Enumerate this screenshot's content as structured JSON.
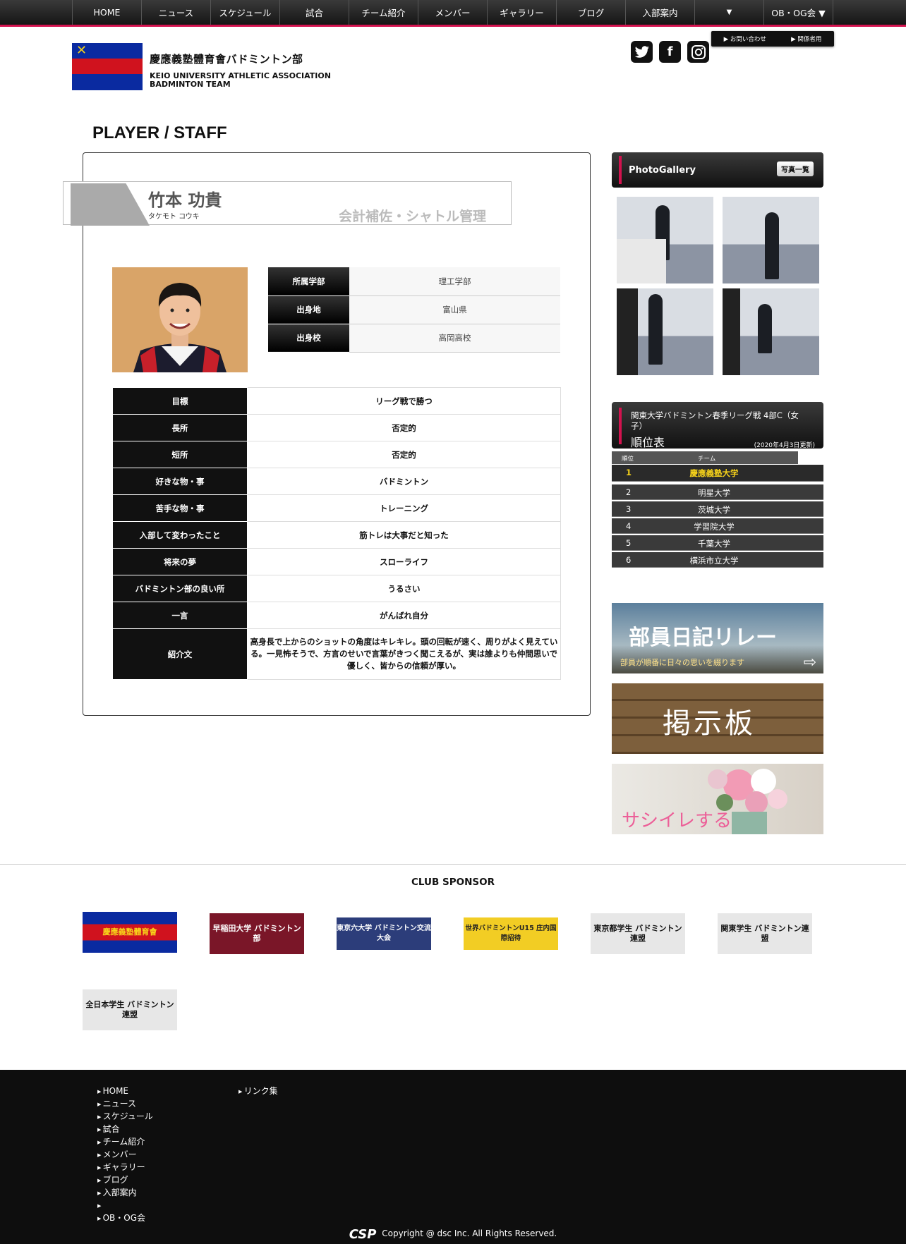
{
  "nav": {
    "items": [
      "HOME",
      "ニュース",
      "スケジュール",
      "試合",
      "チーム紹介",
      "メンバー",
      "ギャラリー",
      "ブログ",
      "入部案内",
      "▼",
      "OB・OG会 ▼"
    ],
    "sub": [
      "▶ お問い合わせ",
      "▶ 関係者用"
    ]
  },
  "site": {
    "title": "慶應義塾體育會バドミントン部",
    "subtitle": "KEIO UNIVERSITY ATHLETIC ASSOCIATION BADMINTON TEAM",
    "social": [
      "twitter-icon",
      "facebook-icon",
      "instagram-icon"
    ]
  },
  "page_title": "PLAYER / STAFF",
  "player": {
    "name": "竹本 功貴",
    "kana": "タケモト コウキ",
    "role": "会計補佐・シャトル管理",
    "info": [
      {
        "k": "所属学部",
        "v": "理工学部"
      },
      {
        "k": "出身地",
        "v": "富山県"
      },
      {
        "k": "出身校",
        "v": "高岡高校"
      }
    ],
    "profile": [
      {
        "k": "目標",
        "v": "リーグ戦で勝つ"
      },
      {
        "k": "長所",
        "v": "否定的"
      },
      {
        "k": "短所",
        "v": "否定的"
      },
      {
        "k": "好きな物・事",
        "v": "バドミントン"
      },
      {
        "k": "苦手な物・事",
        "v": "トレーニング"
      },
      {
        "k": "入部して変わったこと",
        "v": "筋トレは大事だと知った"
      },
      {
        "k": "将来の夢",
        "v": "スローライフ"
      },
      {
        "k": "バドミントン部の良い所",
        "v": "うるさい"
      },
      {
        "k": "一言",
        "v": "がんばれ自分"
      },
      {
        "k": "紹介文",
        "v": "高身長で上からのショットの角度はキレキレ。頭の回転が速く、周りがよく見えている。一見怖そうで、方言のせいで言葉がきつく聞こえるが、実は誰よりも仲間思いで優しく、皆からの信頼が厚い。"
      }
    ]
  },
  "gallery": {
    "title": "PhotoGallery",
    "button": "写真一覧"
  },
  "ranking": {
    "title": "関東大学バドミントン春季リーグ戦 4部C（女子）",
    "big": "順位表",
    "date": "(2020年4月3日更新)",
    "col_rank": "順位",
    "col_team": "チーム",
    "rows": [
      {
        "n": "1",
        "t": "慶應義塾大学"
      },
      {
        "n": "2",
        "t": "明星大学"
      },
      {
        "n": "3",
        "t": "茨城大学"
      },
      {
        "n": "4",
        "t": "学習院大学"
      },
      {
        "n": "5",
        "t": "千葉大学"
      },
      {
        "n": "6",
        "t": "横浜市立大学"
      }
    ]
  },
  "banners": {
    "diary": "部員日記リレー",
    "diary_sub": "部員が順番に日々の思いを綴ります",
    "board": "掲示板",
    "sashiire": "サシイレする"
  },
  "sponsor": {
    "title": "CLUB SPONSOR",
    "items": [
      "慶應義塾體育會",
      "早稲田大学 バドミントン部",
      "東京六大学 バドミントン交流大会",
      "世界バドミントンU15 庄内国際招待",
      "東京都学生 バドミントン連盟",
      "関東学生 バドミントン連盟",
      "全日本学生 バドミントン連盟"
    ]
  },
  "footer": {
    "col1": [
      "HOME",
      "ニュース",
      "スケジュール",
      "試合",
      "チーム紹介",
      "メンバー",
      "ギャラリー",
      "ブログ",
      "入部案内",
      "",
      "OB・OG会"
    ],
    "col2": [
      "リンク集"
    ],
    "logo": "CSP",
    "copyright": "Copyright @ dsc Inc. All Rights Reserved."
  },
  "colors": {
    "accent": "#d3124e",
    "dark": "#111111",
    "gold": "#f7d21a"
  }
}
